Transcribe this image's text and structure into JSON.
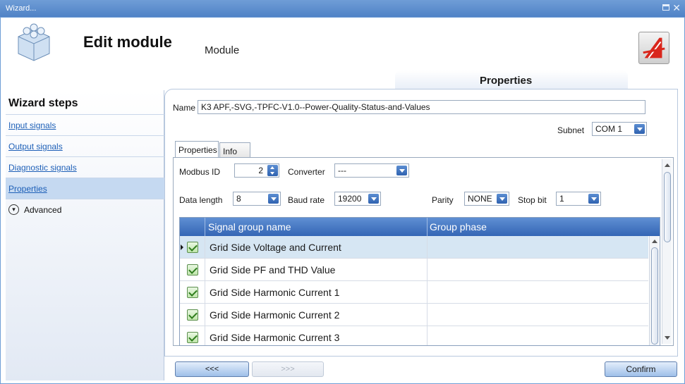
{
  "window": {
    "title": "Wizard..."
  },
  "header": {
    "title": "Edit module",
    "subtitle": "Module",
    "properties_tab": "Properties"
  },
  "sidebar": {
    "title": "Wizard steps",
    "items": [
      {
        "label": "Input signals"
      },
      {
        "label": "Output signals"
      },
      {
        "label": "Diagnostic signals"
      },
      {
        "label": "Properties"
      }
    ],
    "advanced_label": "Advanced"
  },
  "form": {
    "name_label": "Name",
    "name_value": "K3 APF,-SVG,-TPFC-V1.0--Power-Quality-Status-and-Values",
    "subnet_label": "Subnet",
    "subnet_value": "COM 1",
    "tabs": [
      {
        "label": "Properties"
      },
      {
        "label": "Info"
      }
    ],
    "modbus_id_label": "Modbus ID",
    "modbus_id_value": "2",
    "converter_label": "Converter",
    "converter_value": "---",
    "data_length_label": "Data length",
    "data_length_value": "8",
    "baud_rate_label": "Baud rate",
    "baud_rate_value": "19200",
    "parity_label": "Parity",
    "parity_value": "NONE",
    "stop_bit_label": "Stop bit",
    "stop_bit_value": "1"
  },
  "grid": {
    "columns": [
      "Signal group name",
      "Group phase"
    ],
    "rows": [
      {
        "name": "Grid Side Voltage and Current",
        "phase": "",
        "checked": true
      },
      {
        "name": "Grid Side PF and THD Value",
        "phase": "",
        "checked": true
      },
      {
        "name": "Grid Side Harmonic Current 1",
        "phase": "",
        "checked": true
      },
      {
        "name": "Grid Side Harmonic Current 2",
        "phase": "",
        "checked": true
      },
      {
        "name": "Grid Side Harmonic Current 3",
        "phase": "",
        "checked": true
      }
    ]
  },
  "buttons": {
    "back": "<<<",
    "next": ">>>",
    "confirm": "Confirm"
  },
  "colors": {
    "accent": "#3466b5",
    "selected_row": "#d6e6f3",
    "link": "#1d5fb7"
  }
}
